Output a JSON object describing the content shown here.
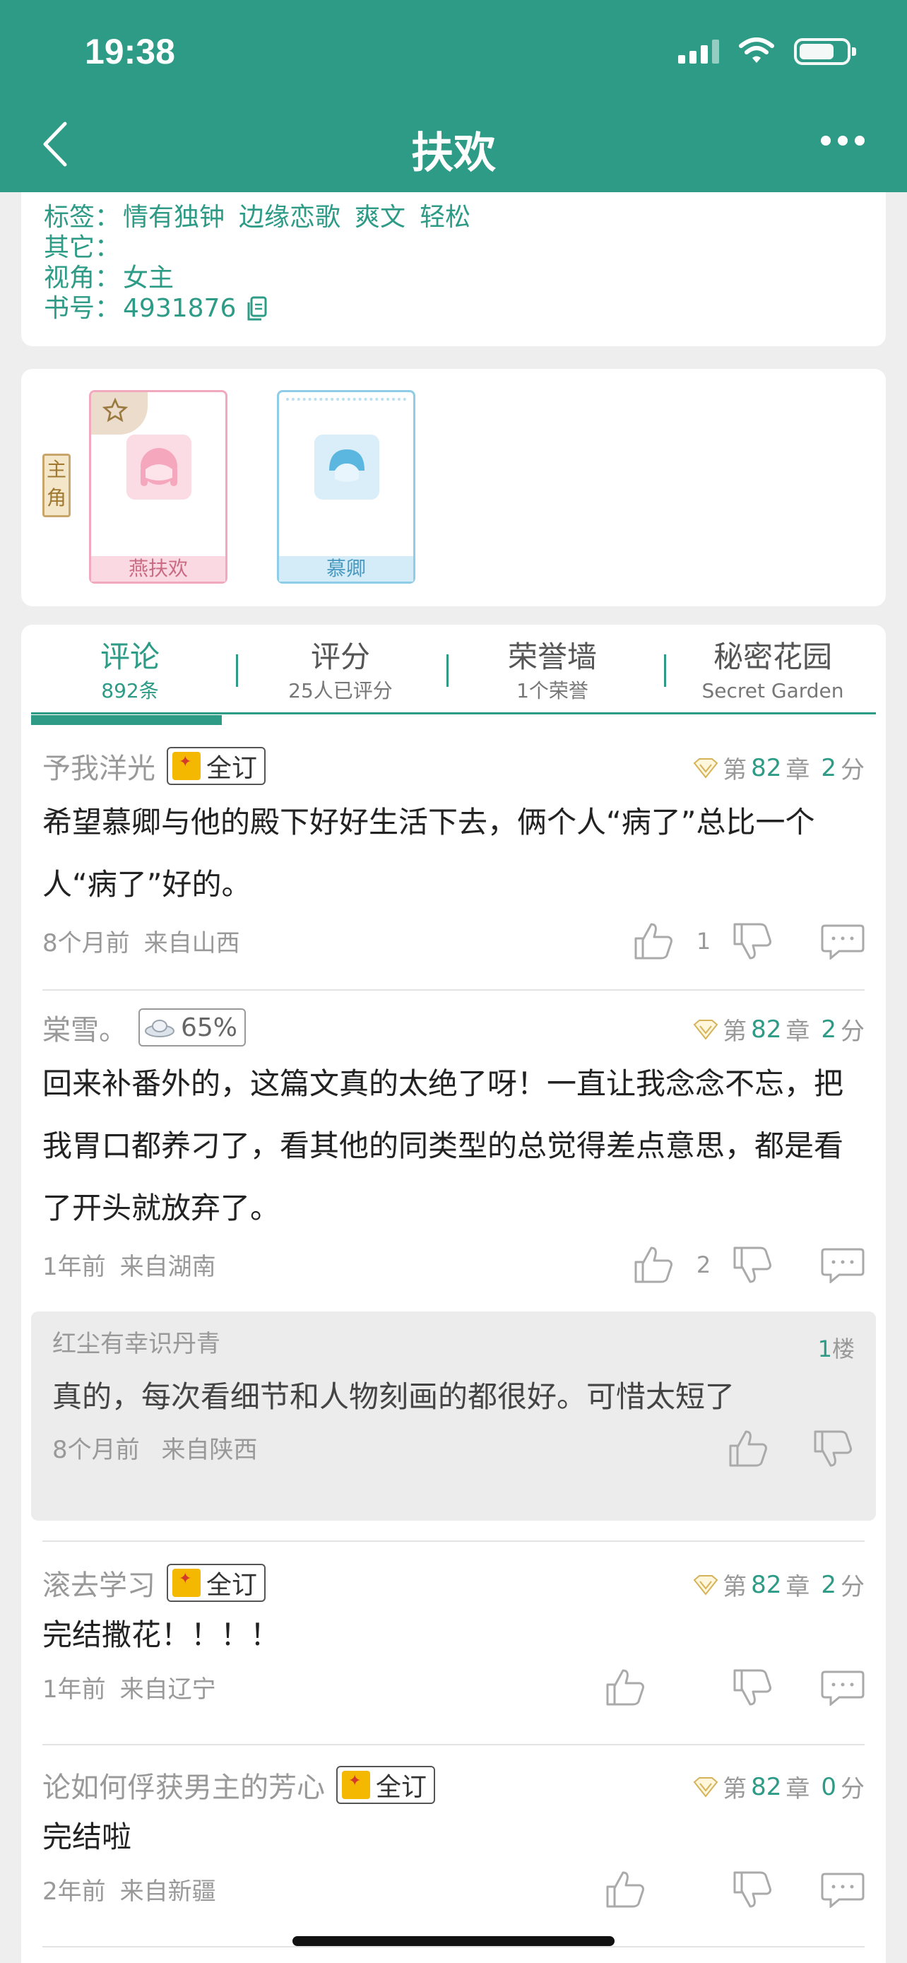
{
  "status_bar": {
    "time": "19:38"
  },
  "nav": {
    "title": "扶欢"
  },
  "info": {
    "tags_label": "标签：",
    "tags": [
      "情有独钟",
      "边缘恋歌",
      "爽文",
      "轻松"
    ],
    "other_label": "其它：",
    "view_label": "视角：",
    "view_value": "女主",
    "book_label": "书号：",
    "book_value": "4931876"
  },
  "roles": {
    "tag": "主角",
    "items": [
      {
        "name": "燕扶欢",
        "color": "#f1a9bd"
      },
      {
        "name": "慕卿",
        "color": "#8fcce8"
      }
    ]
  },
  "tabs": [
    {
      "title": "评论",
      "sub": "892条"
    },
    {
      "title": "评分",
      "sub": "25人已评分"
    },
    {
      "title": "荣誉墙",
      "sub": "1个荣誉"
    },
    {
      "title": "秘密花园",
      "sub": "Secret Garden"
    }
  ],
  "comments": [
    {
      "user": "予我洋光",
      "badge": "全订",
      "chapter_prefix": "第",
      "chapter": "82",
      "chapter_suffix": "章",
      "score": "2",
      "score_unit": "分",
      "text": "希望慕卿与他的殿下好好生活下去，俩个人“病了”总比一个人“病了”好的。",
      "time": "8个月前",
      "place": "来自山西",
      "likes": "1"
    },
    {
      "user": "棠雪。",
      "badge": "65%",
      "chapter_prefix": "第",
      "chapter": "82",
      "chapter_suffix": "章",
      "score": "2",
      "score_unit": "分",
      "text": "回来补番外的，这篇文真的太绝了呀！一直让我念念不忘，把我胃口都养刁了，看其他的同类型的总觉得差点意思，都是看了开头就放弃了。",
      "time": "1年前",
      "place": "来自湖南",
      "likes": "2"
    },
    {
      "user": "滚去学习",
      "badge": "全订",
      "chapter_prefix": "第",
      "chapter": "82",
      "chapter_suffix": "章",
      "score": "2",
      "score_unit": "分",
      "text": "完结撒花！！！！",
      "time": "1年前",
      "place": "来自辽宁",
      "likes": ""
    },
    {
      "user": "论如何俘获男主的芳心",
      "badge": "全订",
      "chapter_prefix": "第",
      "chapter": "82",
      "chapter_suffix": "章",
      "score": "0",
      "score_unit": "分",
      "text": "完结啦",
      "time": "2年前",
      "place": "来自新疆",
      "likes": ""
    }
  ],
  "reply": {
    "user": "红尘有幸识丹青",
    "floor": "1",
    "floor_unit": "楼",
    "text": "真的，每次看细节和人物刻画的都很好。可惜太短了",
    "time": "8个月前",
    "place": "来自陕西"
  },
  "colors": {
    "brand": "#2d9b86",
    "background": "#eeeeee"
  }
}
